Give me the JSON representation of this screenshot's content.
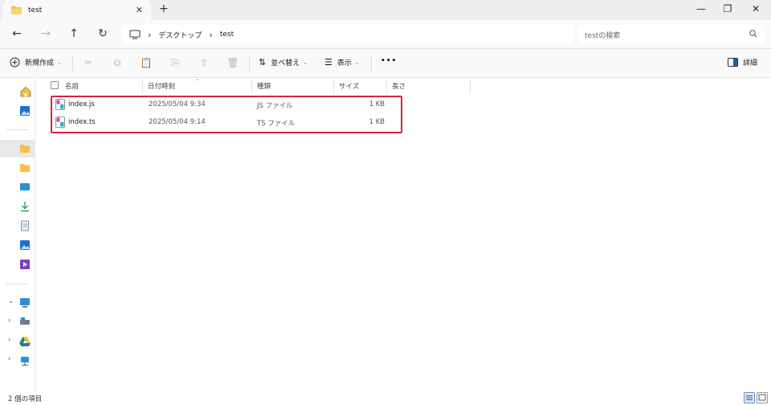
{
  "tab": {
    "title": "test"
  },
  "address": {
    "crumbs": [
      "デスクトップ",
      "test"
    ]
  },
  "search": {
    "placeholder": "testの検索"
  },
  "toolbar": {
    "new_label": "新規作成",
    "sort_label": "並べ替え",
    "view_label": "表示",
    "more_label": "•••",
    "details_label": "詳細"
  },
  "columns": {
    "name": "名前",
    "date": "日付時刻",
    "type": "種類",
    "size": "サイズ",
    "length": "長さ"
  },
  "files": [
    {
      "name": "index.js",
      "date": "2025/05/04 9:34",
      "type": "JS ファイル",
      "size": "1 KB"
    },
    {
      "name": "index.ts",
      "date": "2025/05/04 9:14",
      "type": "TS ファイル",
      "size": "1 KB"
    }
  ],
  "status": {
    "count": "2 個の項目"
  },
  "colors": {
    "accent": "#0067c0",
    "highlight": "#d7263d",
    "folder": "#f5c043"
  }
}
